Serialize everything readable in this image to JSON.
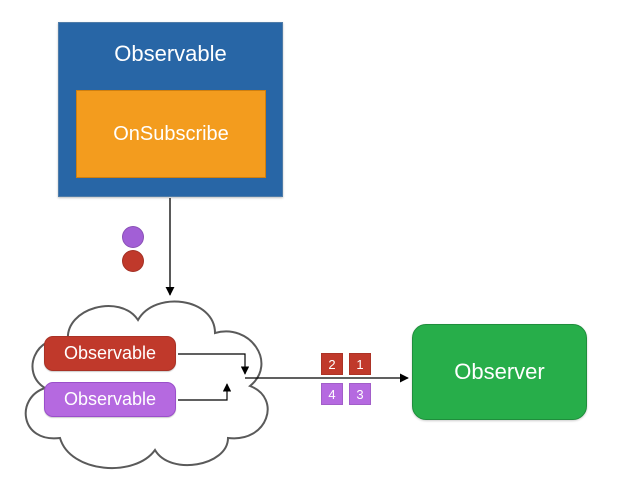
{
  "observable_outer": {
    "title": "Observable"
  },
  "onsubscribe": {
    "label": "OnSubscribe"
  },
  "emitted": {
    "purple": {
      "color": "#a25fd6",
      "name": "purple-event"
    },
    "red": {
      "color": "#c0392b",
      "name": "red-event"
    }
  },
  "cloud": {
    "inner_observables": [
      {
        "label": "Observable",
        "color": "#c0392b",
        "name": "inner-observable-red"
      },
      {
        "label": "Observable",
        "color": "#b569e0",
        "name": "inner-observable-purple"
      }
    ]
  },
  "observer": {
    "label": "Observer"
  },
  "stream_items": {
    "row1": [
      {
        "value": "2",
        "color": "#c0392b"
      },
      {
        "value": "1",
        "color": "#c0392b"
      }
    ],
    "row2": [
      {
        "value": "4",
        "color": "#b569e0"
      },
      {
        "value": "3",
        "color": "#b569e0"
      }
    ]
  },
  "colors": {
    "blue": "#2866a6",
    "orange": "#f39c1e",
    "red": "#c0392b",
    "purple": "#b569e0",
    "green": "#27ae4a"
  }
}
